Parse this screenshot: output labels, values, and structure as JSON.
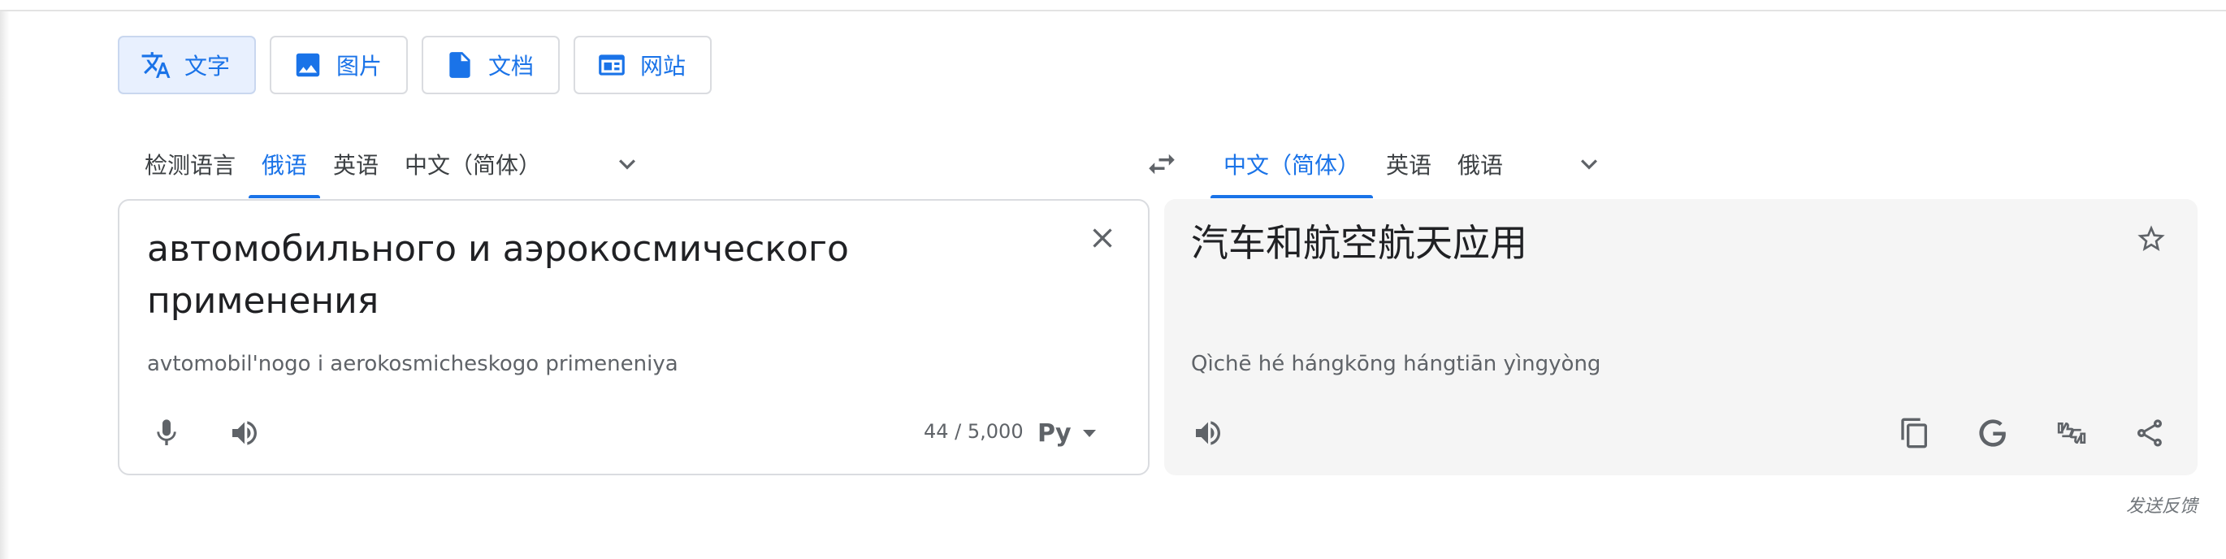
{
  "mode_tabs": [
    {
      "label": "文字",
      "icon": "translate-icon",
      "active": true
    },
    {
      "label": "图片",
      "icon": "image-icon",
      "active": false
    },
    {
      "label": "文档",
      "icon": "document-icon",
      "active": false
    },
    {
      "label": "网站",
      "icon": "website-icon",
      "active": false
    }
  ],
  "source_languages": {
    "items": [
      "检测语言",
      "俄语",
      "英语",
      "中文（简体）"
    ],
    "selected": "俄语"
  },
  "target_languages": {
    "items": [
      "中文（简体）",
      "英语",
      "俄语"
    ],
    "selected": "中文（简体）"
  },
  "source": {
    "text": "автомобильного и аэрокосмического применения",
    "transliteration": "avtomobil'nogo i aerokosmicheskogo primeneniya",
    "char_count": "44 / 5,000",
    "ime_label": "Ру"
  },
  "target": {
    "text": "汽车和航空航天应用",
    "transliteration": "Qìchē hé hángkōng hángtiān yìngyòng"
  },
  "feedback_label": "发送反馈",
  "colors": {
    "accent": "#1a73e8",
    "active_tab_bg": "#e8f0fe",
    "target_panel_bg": "#f5f5f5",
    "icon_gray": "#5f6368"
  }
}
